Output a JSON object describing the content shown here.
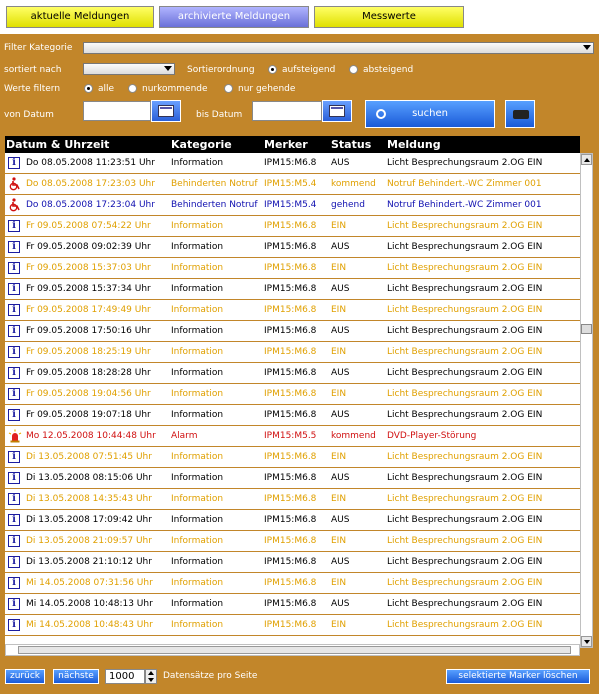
{
  "tabs": [
    {
      "label": "aktuelle Meldungen"
    },
    {
      "label": "archivierte Meldungen"
    },
    {
      "label": "Messwerte"
    }
  ],
  "filter": {
    "kategorie_label": "Filter Kategorie",
    "sortiert_label": "sortiert nach",
    "sortierordnung_label": "Sortierordnung",
    "aufsteigend_label": "aufsteigend",
    "absteigend_label": "absteigend",
    "werte_label": "Werte filtern",
    "alle_label": "alle",
    "nurkommende_label": "nurkommende",
    "nurgehende_label": "nur gehende",
    "von_label": "von Datum",
    "bis_label": "bis Datum",
    "suchen_label": "suchen"
  },
  "table": {
    "headers": [
      "Datum & Uhrzeit",
      "Kategorie",
      "Merker",
      "Status",
      "Meldung"
    ],
    "colors": {
      "black": "#000000",
      "orange": "#e0a000",
      "blue": "#1010b0",
      "red": "#d01010"
    },
    "rows": [
      {
        "icon": "info-icon",
        "color": "black",
        "datum": "Do 08.05.2008 11:23:51 Uhr",
        "kategorie": "Information",
        "merker": "IPM15:M6.8",
        "status": "AUS",
        "meldung": "Licht Besprechungsraum 2.OG EIN"
      },
      {
        "icon": "wheelchair-icon",
        "color": "orange",
        "datum": "Do 08.05.2008 17:23:03 Uhr",
        "kategorie": "Behinderten Notruf",
        "merker": "IPM15:M5.4",
        "status": "kommend",
        "meldung": "Notruf Behindert.-WC Zimmer 001"
      },
      {
        "icon": "wheelchair-icon",
        "color": "blue",
        "datum": "Do 08.05.2008 17:23:04 Uhr",
        "kategorie": "Behinderten Notruf",
        "merker": "IPM15:M5.4",
        "status": "gehend",
        "meldung": "Notruf Behindert.-WC Zimmer 001"
      },
      {
        "icon": "info-icon",
        "color": "orange",
        "datum": "Fr 09.05.2008 07:54:22 Uhr",
        "kategorie": "Information",
        "merker": "IPM15:M6.8",
        "status": "EIN",
        "meldung": "Licht Besprechungsraum 2.OG EIN"
      },
      {
        "icon": "info-icon",
        "color": "black",
        "datum": "Fr 09.05.2008 09:02:39 Uhr",
        "kategorie": "Information",
        "merker": "IPM15:M6.8",
        "status": "AUS",
        "meldung": "Licht Besprechungsraum 2.OG EIN"
      },
      {
        "icon": "info-icon",
        "color": "orange",
        "datum": "Fr 09.05.2008 15:37:03 Uhr",
        "kategorie": "Information",
        "merker": "IPM15:M6.8",
        "status": "EIN",
        "meldung": "Licht Besprechungsraum 2.OG EIN"
      },
      {
        "icon": "info-icon",
        "color": "black",
        "datum": "Fr 09.05.2008 15:37:34 Uhr",
        "kategorie": "Information",
        "merker": "IPM15:M6.8",
        "status": "AUS",
        "meldung": "Licht Besprechungsraum 2.OG EIN"
      },
      {
        "icon": "info-icon",
        "color": "orange",
        "datum": "Fr 09.05.2008 17:49:49 Uhr",
        "kategorie": "Information",
        "merker": "IPM15:M6.8",
        "status": "EIN",
        "meldung": "Licht Besprechungsraum 2.OG EIN"
      },
      {
        "icon": "info-icon",
        "color": "black",
        "datum": "Fr 09.05.2008 17:50:16 Uhr",
        "kategorie": "Information",
        "merker": "IPM15:M6.8",
        "status": "AUS",
        "meldung": "Licht Besprechungsraum 2.OG EIN"
      },
      {
        "icon": "info-icon",
        "color": "orange",
        "datum": "Fr 09.05.2008 18:25:19 Uhr",
        "kategorie": "Information",
        "merker": "IPM15:M6.8",
        "status": "EIN",
        "meldung": "Licht Besprechungsraum 2.OG EIN"
      },
      {
        "icon": "info-icon",
        "color": "black",
        "datum": "Fr 09.05.2008 18:28:28 Uhr",
        "kategorie": "Information",
        "merker": "IPM15:M6.8",
        "status": "AUS",
        "meldung": "Licht Besprechungsraum 2.OG EIN"
      },
      {
        "icon": "info-icon",
        "color": "orange",
        "datum": "Fr 09.05.2008 19:04:56 Uhr",
        "kategorie": "Information",
        "merker": "IPM15:M6.8",
        "status": "EIN",
        "meldung": "Licht Besprechungsraum 2.OG EIN"
      },
      {
        "icon": "info-icon",
        "color": "black",
        "datum": "Fr 09.05.2008 19:07:18 Uhr",
        "kategorie": "Information",
        "merker": "IPM15:M6.8",
        "status": "AUS",
        "meldung": "Licht Besprechungsraum 2.OG EIN"
      },
      {
        "icon": "alarm-icon",
        "color": "red",
        "datum": "Mo 12.05.2008 10:44:48 Uhr",
        "kategorie": "Alarm",
        "merker": "IPM15:M5.5",
        "status": "kommend",
        "meldung": "DVD-Player-Störung"
      },
      {
        "icon": "info-icon",
        "color": "orange",
        "datum": "Di 13.05.2008 07:51:45 Uhr",
        "kategorie": "Information",
        "merker": "IPM15:M6.8",
        "status": "EIN",
        "meldung": "Licht Besprechungsraum 2.OG EIN"
      },
      {
        "icon": "info-icon",
        "color": "black",
        "datum": "Di 13.05.2008 08:15:06 Uhr",
        "kategorie": "Information",
        "merker": "IPM15:M6.8",
        "status": "AUS",
        "meldung": "Licht Besprechungsraum 2.OG EIN"
      },
      {
        "icon": "info-icon",
        "color": "orange",
        "datum": "Di 13.05.2008 14:35:43 Uhr",
        "kategorie": "Information",
        "merker": "IPM15:M6.8",
        "status": "EIN",
        "meldung": "Licht Besprechungsraum 2.OG EIN"
      },
      {
        "icon": "info-icon",
        "color": "black",
        "datum": "Di 13.05.2008 17:09:42 Uhr",
        "kategorie": "Information",
        "merker": "IPM15:M6.8",
        "status": "AUS",
        "meldung": "Licht Besprechungsraum 2.OG EIN"
      },
      {
        "icon": "info-icon",
        "color": "orange",
        "datum": "Di 13.05.2008 21:09:57 Uhr",
        "kategorie": "Information",
        "merker": "IPM15:M6.8",
        "status": "EIN",
        "meldung": "Licht Besprechungsraum 2.OG EIN"
      },
      {
        "icon": "info-icon",
        "color": "black",
        "datum": "Di 13.05.2008 21:10:12 Uhr",
        "kategorie": "Information",
        "merker": "IPM15:M6.8",
        "status": "AUS",
        "meldung": "Licht Besprechungsraum 2.OG EIN"
      },
      {
        "icon": "info-icon",
        "color": "orange",
        "datum": "Mi 14.05.2008 07:31:56 Uhr",
        "kategorie": "Information",
        "merker": "IPM15:M6.8",
        "status": "EIN",
        "meldung": "Licht Besprechungsraum 2.OG EIN"
      },
      {
        "icon": "info-icon",
        "color": "black",
        "datum": "Mi 14.05.2008 10:48:13 Uhr",
        "kategorie": "Information",
        "merker": "IPM15:M6.8",
        "status": "AUS",
        "meldung": "Licht Besprechungsraum 2.OG EIN"
      },
      {
        "icon": "info-icon",
        "color": "orange",
        "datum": "Mi 14.05.2008 10:48:43 Uhr",
        "kategorie": "Information",
        "merker": "IPM15:M6.8",
        "status": "EIN",
        "meldung": "Licht Besprechungsraum 2.OG EIN"
      }
    ]
  },
  "footer": {
    "zurueck_label": "zurück",
    "naechste_label": "nächste",
    "page_size": "1000",
    "pro_seite_label": "Datensätze pro Seite",
    "loeschen_label": "selektierte Marker löschen"
  }
}
